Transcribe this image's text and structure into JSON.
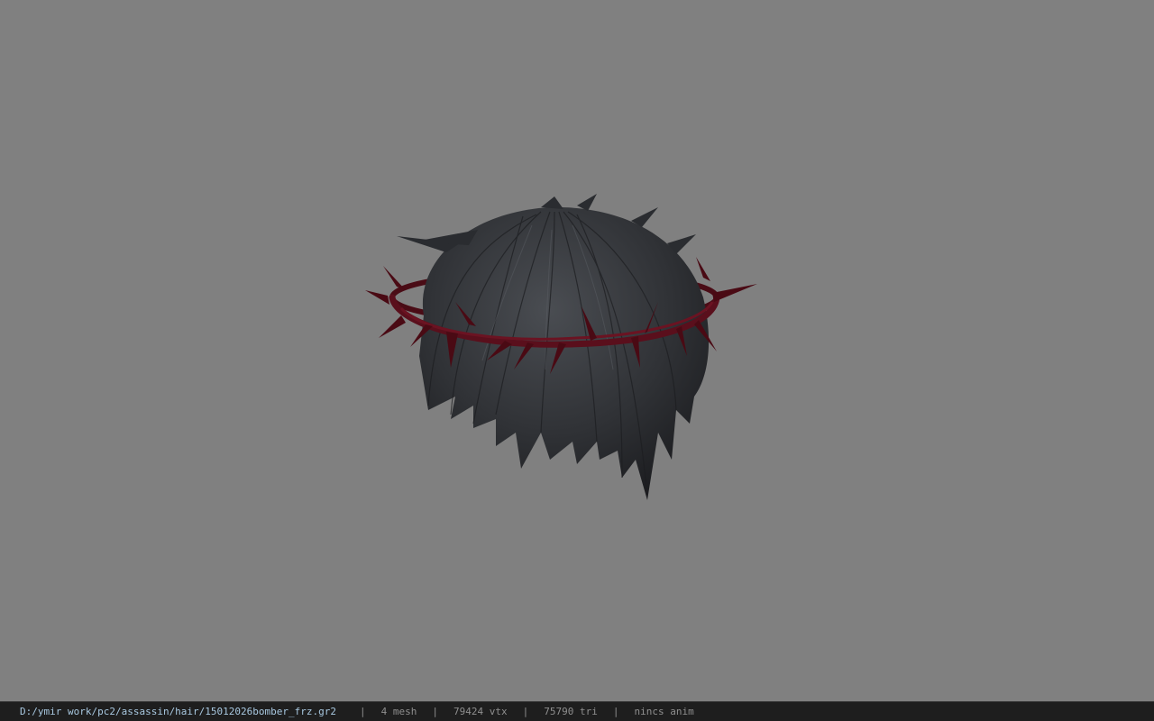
{
  "viewer": {
    "background_color": "#808080",
    "model": {
      "hair_color": "#2e3033",
      "crown_color": "#5a0f1c"
    }
  },
  "status_bar": {
    "file_path": "D:/ymir work/pc2/assassin/hair/15012026bomber_frz.gr2",
    "separator": "|",
    "mesh_count": "4 mesh",
    "vertex_count": "79424 vtx",
    "triangle_count": "75790 tri",
    "animation": "nincs anim"
  }
}
